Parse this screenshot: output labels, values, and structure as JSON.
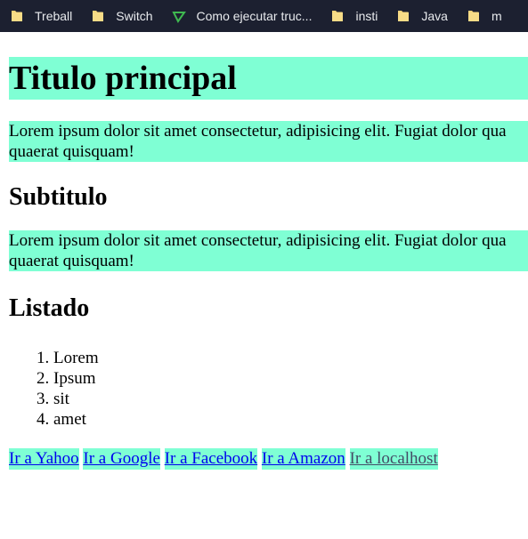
{
  "bookmarks": [
    {
      "label": "Treball",
      "icon": "folder-icon"
    },
    {
      "label": "Switch",
      "icon": "folder-icon"
    },
    {
      "label": "Como ejecutar truc...",
      "icon": "green-triangle-icon"
    },
    {
      "label": "insti",
      "icon": "folder-icon"
    },
    {
      "label": "Java",
      "icon": "folder-icon"
    },
    {
      "label": "m",
      "icon": "folder-icon"
    }
  ],
  "page": {
    "title": "Titulo principal",
    "paragraph1_line1": "Lorem ipsum dolor sit amet consectetur, adipisicing elit. Fugiat dolor qua",
    "paragraph1_line2": "quaerat quisquam!",
    "subtitle": "Subtitulo",
    "paragraph2_line1": "Lorem ipsum dolor sit amet consectetur, adipisicing elit. Fugiat dolor qua",
    "paragraph2_line2": "quaerat quisquam!",
    "list_heading": "Listado",
    "list_items": [
      "Lorem",
      "Ipsum",
      "sit",
      "amet"
    ],
    "links": [
      {
        "label": "Ir a Yahoo"
      },
      {
        "label": "Ir a Google"
      },
      {
        "label": "Ir a Facebook"
      },
      {
        "label": "Ir a Amazon"
      },
      {
        "label": "Ir a localhost"
      }
    ]
  },
  "colors": {
    "highlight": "#7fffd4",
    "bookmark_bar": "#1c2030",
    "link": "#0000ee",
    "visited_link": "#444b66"
  }
}
